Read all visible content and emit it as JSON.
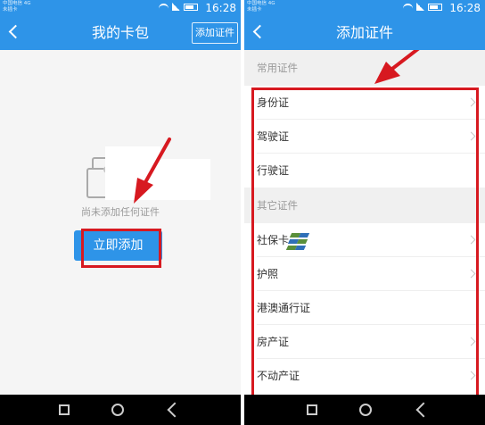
{
  "left_screen": {
    "status_bar": {
      "carrier": "中国电信 4G\n未插卡",
      "time": "16:28"
    },
    "nav_bar": {
      "title": "我的卡包",
      "action": "添加证件"
    },
    "empty_state": {
      "text": "尚未添加任何证件",
      "button_label": "立即添加"
    }
  },
  "right_screen": {
    "status_bar": {
      "carrier": "中国电信 4G\n未插卡",
      "time": "16:28"
    },
    "nav_bar": {
      "title": "添加证件"
    },
    "sections": [
      {
        "header": "常用证件",
        "items": [
          {
            "label": "身份证"
          },
          {
            "label": "驾驶证"
          },
          {
            "label": "行驶证"
          }
        ]
      },
      {
        "header": "其它证件",
        "items": [
          {
            "label": "社保卡"
          },
          {
            "label": "护照"
          },
          {
            "label": "港澳通行证"
          },
          {
            "label": "房产证"
          },
          {
            "label": "不动产证"
          }
        ]
      }
    ]
  },
  "colors": {
    "primary": "#2e94e8",
    "annotation_red": "#d71920",
    "section_bg": "#f0f0f0"
  }
}
